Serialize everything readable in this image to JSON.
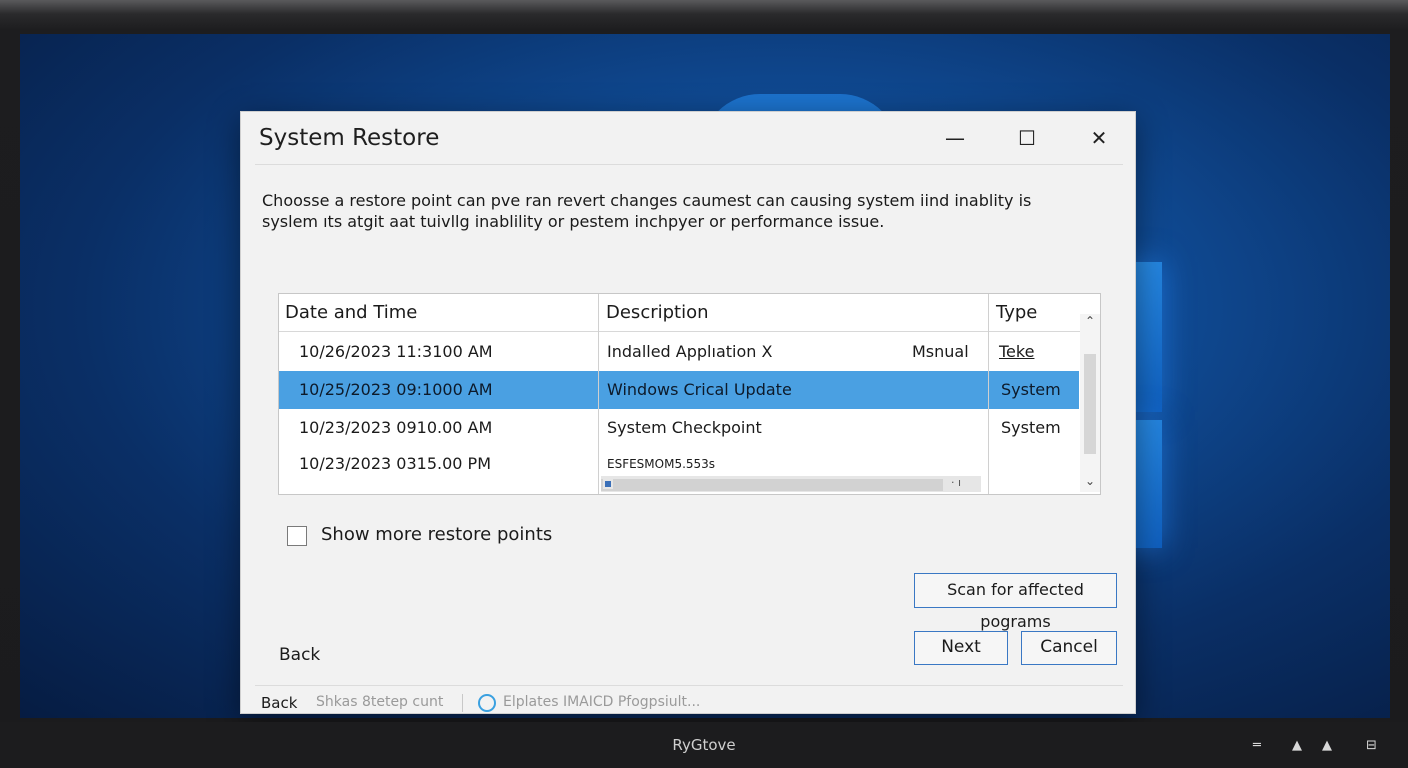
{
  "dialog": {
    "title": "System Restore",
    "instructions": "Choosse a restore point can pve ran revert changes caumest can causing system iind inablity is syslem ıts atgit aat tuivllg inablility or pestem inchpyer or performance issue.",
    "table": {
      "headers": [
        "Date and Time",
        "Description",
        "Type"
      ],
      "rows": [
        {
          "date": "10/26/2023 11:3100 AM",
          "description": "Indalled Applıation X",
          "extra": "Msnual",
          "type": "Teke"
        },
        {
          "date": "10/25/2023 09:1000 AM",
          "description": "Windows Crical Update",
          "extra": "",
          "type": "System"
        },
        {
          "date": "10/23/2023 0910.00 AM",
          "description": "System Checkpoint",
          "extra": "",
          "type": "System"
        },
        {
          "date": "10/23/2023 0315.00 PM",
          "description": "ESFESMOM5.553s",
          "extra": "",
          "type": ""
        }
      ]
    },
    "checkbox_label": "Show more restore points",
    "scan_button": "Scan for affected pograms",
    "next_button": "Next",
    "cancel_button": "Cancel",
    "back_link": "Back",
    "status": {
      "back": "Back",
      "item1": "Shkas 8tetep cunt",
      "item2": "Elplates IMAICD Pfogpsiult..."
    }
  },
  "titlebar_buttons": {
    "minimize": "—",
    "maximize": "☐",
    "close": "✕"
  },
  "taskbar": {
    "title": "RyGtove",
    "tray": [
      "═",
      "▲",
      "▲",
      "⊟"
    ]
  },
  "colors": {
    "selection": "#4aa0e2",
    "button_border": "#3a78c4",
    "desktop": "#0f4a93"
  }
}
